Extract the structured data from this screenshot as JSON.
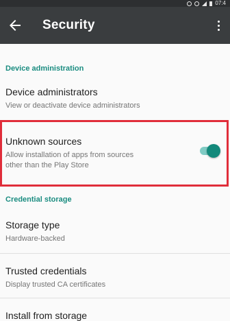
{
  "status_bar": {
    "time": "07:4"
  },
  "app_bar": {
    "title": "Security",
    "back_icon": "arrow-back-icon",
    "menu_icon": "more-vert-icon"
  },
  "sections": {
    "device_admin": {
      "header": "Device administration",
      "device_administrators": {
        "title": "Device administrators",
        "summary": "View or deactivate device administrators"
      },
      "unknown_sources": {
        "title": "Unknown sources",
        "summary_line1": "Allow installation of apps from sources",
        "summary_line2": "other than the Play Store",
        "enabled": true
      }
    },
    "credential_storage": {
      "header": "Credential storage",
      "storage_type": {
        "title": "Storage type",
        "summary": "Hardware-backed"
      },
      "trusted_credentials": {
        "title": "Trusted credentials",
        "summary": "Display trusted CA certificates"
      },
      "install_from_storage": {
        "title": "Install from storage"
      }
    }
  },
  "colors": {
    "app_bar": "#3a3d3f",
    "accent": "#13897b",
    "highlight_border": "#e02d3a"
  }
}
